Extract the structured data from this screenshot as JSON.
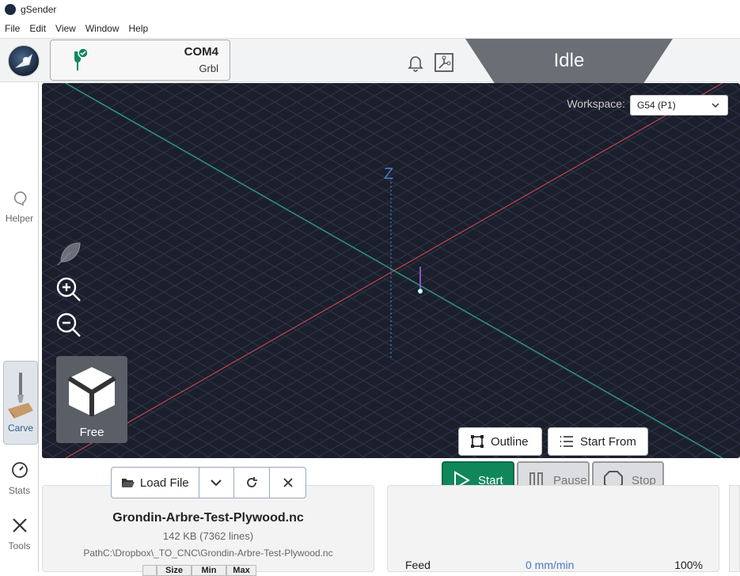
{
  "window": {
    "title": "gSender"
  },
  "menu": {
    "items": [
      "File",
      "Edit",
      "View",
      "Window",
      "Help"
    ]
  },
  "connection": {
    "port": "COM4",
    "firmware": "Grbl"
  },
  "machine": {
    "state": "Idle"
  },
  "sidebar": {
    "items": [
      {
        "label": "Helper"
      },
      {
        "label": "Carve"
      },
      {
        "label": "Stats"
      },
      {
        "label": "Tools"
      }
    ]
  },
  "viewport": {
    "workspace_label": "Workspace:",
    "workspace_value": "G54 (P1)",
    "z_axis_label": "Z",
    "camera_label": "Free",
    "outline_label": "Outline",
    "start_from_label": "Start From"
  },
  "run_controls": {
    "start": "Start",
    "pause": "Pause",
    "stop": "Stop"
  },
  "file": {
    "load_label": "Load File",
    "name": "Grondin-Arbre-Test-Plywood.nc",
    "size": "142 KB (7362 lines)",
    "path": "PathC:\\Dropbox\\_TO_CNC\\Grondin-Arbre-Test-Plywood.nc",
    "table_headers": [
      "Size",
      "Min",
      "Max"
    ]
  },
  "overrides": {
    "feed_label": "Feed",
    "feed_value": "0 mm/min",
    "feed_percent": "100%"
  },
  "colors": {
    "viewport_bg": "#1b1f2c",
    "state_bg": "#6b6e75",
    "start_green": "#10875b",
    "x_axis": "#c0454a",
    "y_axis": "#2aa38a"
  }
}
